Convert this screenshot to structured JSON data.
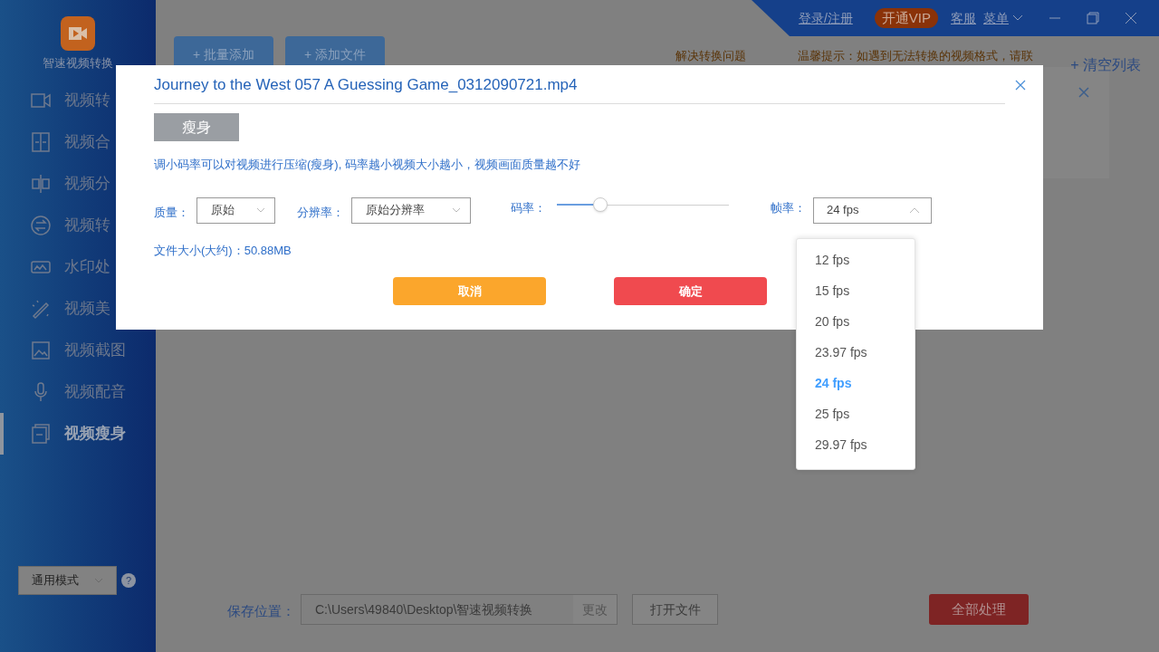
{
  "app": {
    "name": "智速视频转换"
  },
  "sidebar": {
    "items": [
      {
        "label": "视频转",
        "selected": false
      },
      {
        "label": "视频合",
        "selected": false
      },
      {
        "label": "视频分",
        "selected": false
      },
      {
        "label": "视频转",
        "selected": false
      },
      {
        "label": "水印处",
        "selected": false
      },
      {
        "label": "视频美",
        "selected": false
      },
      {
        "label": "视频截图",
        "selected": false
      },
      {
        "label": "视频配音",
        "selected": false
      },
      {
        "label": "视频瘦身",
        "selected": true
      }
    ],
    "mode_select": {
      "value": "通用模式"
    },
    "help": "?"
  },
  "topbar": {
    "login": "登录/注册",
    "vip": "开通VIP",
    "service": "客服",
    "menu": "菜单"
  },
  "toolbar": {
    "buttons": [
      "+ 批量添加",
      "+ 添加文件"
    ],
    "hints": [
      "解决转换问题",
      "温馨提示：如遇到无法转换的视频格式，请联"
    ],
    "clear": "+ 清空列表"
  },
  "dialog": {
    "title": "Journey to the West 057 A Guessing Game_0312090721.mp4",
    "tab": "瘦身",
    "description": "调小码率可以对视频进行压缩(瘦身), 码率越小视频大小越小，视频画面质量越不好",
    "quality": {
      "label": "质量：",
      "value": "原始"
    },
    "resolution": {
      "label": "分辨率：",
      "value": "原始分辨率"
    },
    "bitrate": {
      "label": "码率：",
      "level": 0.25
    },
    "fps": {
      "label": "帧率：",
      "value": "24 fps",
      "expanded": true,
      "options": [
        {
          "label": "12 fps",
          "selected": false
        },
        {
          "label": "15 fps",
          "selected": false
        },
        {
          "label": "20 fps",
          "selected": false
        },
        {
          "label": "23.97 fps",
          "selected": false
        },
        {
          "label": "24 fps",
          "selected": true
        },
        {
          "label": "25 fps",
          "selected": false
        },
        {
          "label": "29.97 fps",
          "selected": false
        }
      ]
    },
    "file_size": "文件大小(大约)：50.88MB",
    "cancel": "取消",
    "confirm": "确定"
  },
  "footer": {
    "save_label": "保存位置：",
    "path": "C:\\Users\\49840\\Desktop\\智速视频转换",
    "change": "更改",
    "open": "打开文件",
    "process_all": "全部处理"
  }
}
